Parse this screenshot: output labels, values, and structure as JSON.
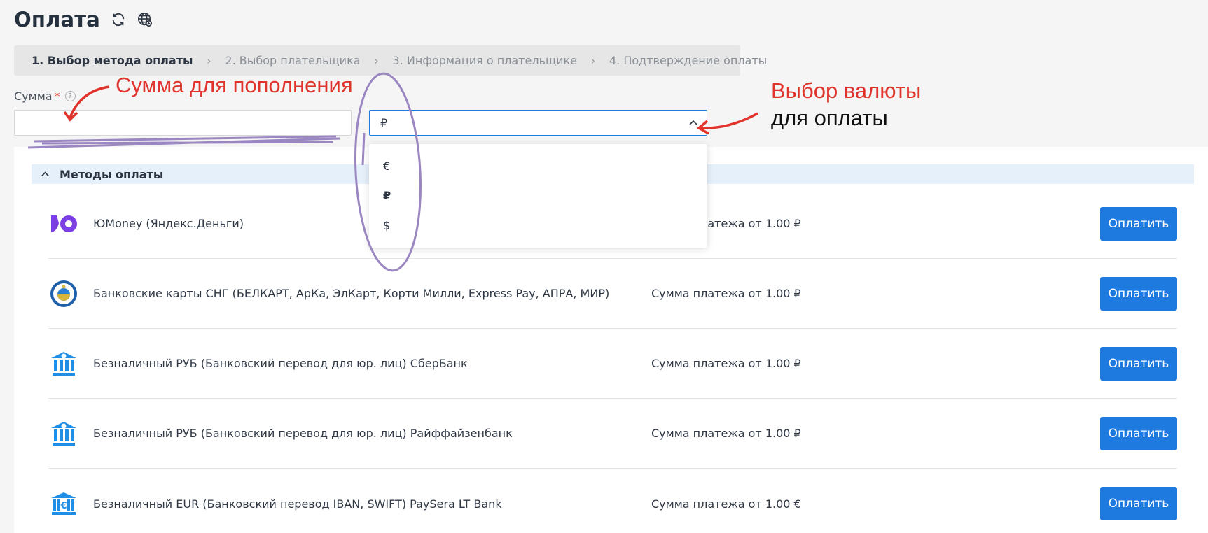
{
  "header": {
    "title": "Оплата",
    "icons": [
      "refresh-icon",
      "globe-icon"
    ]
  },
  "steps": [
    {
      "label": "1. Выбор метода оплаты",
      "active": true
    },
    {
      "label": "2. Выбор плательщика",
      "active": false
    },
    {
      "label": "3. Информация о плательщике",
      "active": false
    },
    {
      "label": "4. Подтверждение оплаты",
      "active": false
    }
  ],
  "amount": {
    "label": "Сумма",
    "required_mark": "*",
    "help": "?",
    "value": ""
  },
  "currency": {
    "selected": "₽",
    "options": [
      "€",
      "₽",
      "$"
    ]
  },
  "methods": {
    "header": "Методы оплаты",
    "pay_label": "Оплатить",
    "items": [
      {
        "name": "ЮMoney (Яндекс.Деньги)",
        "min_sum": "Сумма платежа от 1.00 ₽",
        "icon": "yoomoney-icon"
      },
      {
        "name": "Банковские карты СНГ (БЕЛКАРТ, АрКа, ЭлКарт, Корти Милли, Express Pay, АПРА, МИР)",
        "min_sum": "Сумма платежа от 1.00 ₽",
        "icon": "cis-emblem-icon"
      },
      {
        "name": "Безналичный РУБ (Банковский перевод для юр. лиц) СберБанк",
        "min_sum": "Сумма платежа от 1.00 ₽",
        "icon": "bank-ruble-icon"
      },
      {
        "name": "Безналичный РУБ (Банковский перевод для юр. лиц) Райффайзенбанк",
        "min_sum": "Сумма платежа от 1.00 ₽",
        "icon": "bank-ruble-icon"
      },
      {
        "name": "Безналичный EUR (Банковский перевод IBAN, SWIFT) PaySera LT Bank",
        "min_sum": "Сумма платежа от 1.00 €",
        "icon": "bank-euro-icon"
      }
    ]
  },
  "annotations": {
    "amount_note": "Сумма для пополнения",
    "currency_note_line1": "Выбор валюты",
    "currency_note_line2": "для оплаты"
  },
  "colors": {
    "primary": "#1f7ae0",
    "annotation_red": "#e0332b",
    "annotation_purple": "#9a86c0"
  }
}
